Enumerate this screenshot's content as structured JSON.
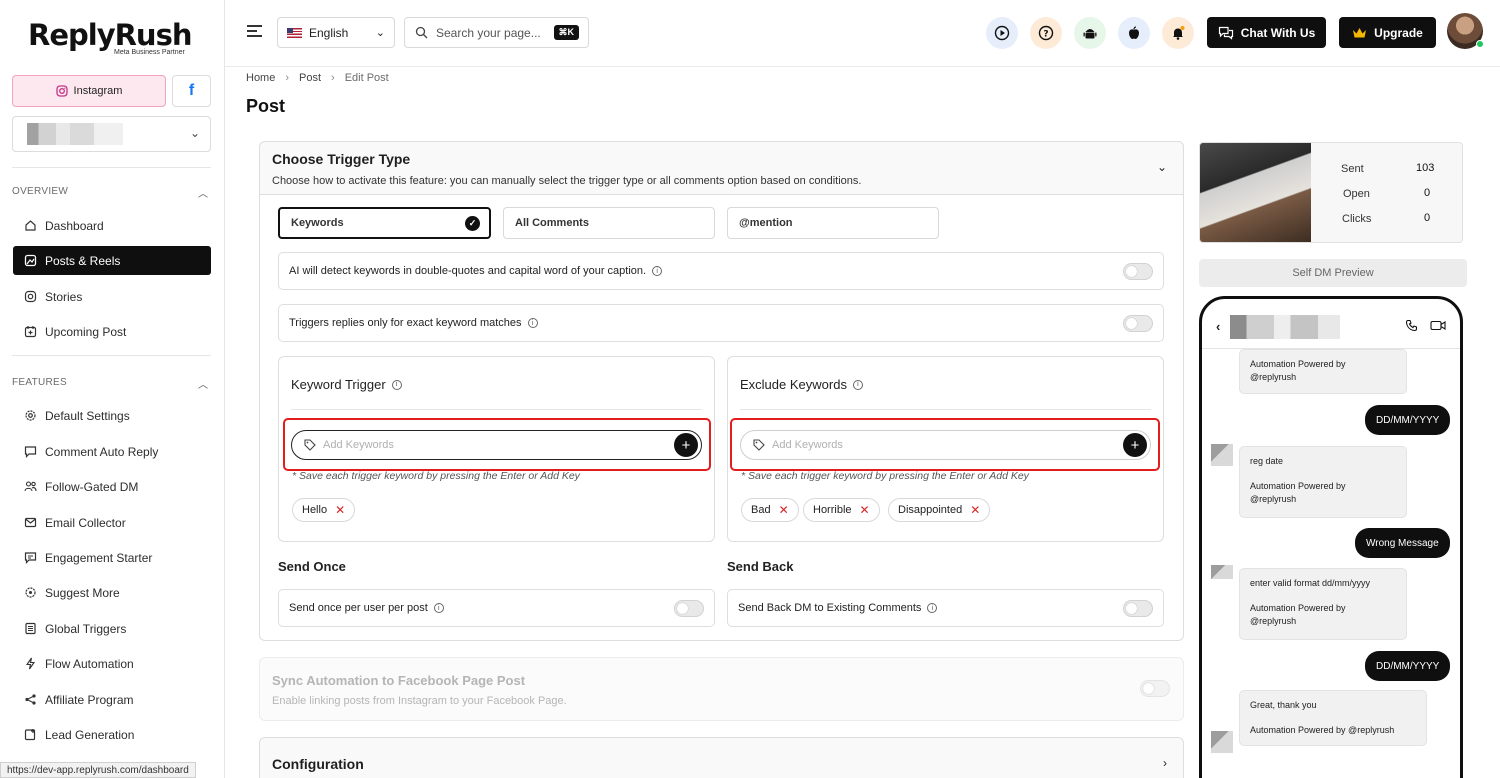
{
  "sidebar": {
    "logo": "ReplyRush",
    "logo_sub": "Meta Business Partner",
    "instagram_label": "Instagram",
    "fb_icon": "f",
    "sections": {
      "overview": "OVERVIEW",
      "features": "FEATURES"
    },
    "overview_items": [
      {
        "label": "Dashboard",
        "icon": "dashboard-icon"
      },
      {
        "label": "Posts & Reels",
        "icon": "posts-icon",
        "active": true
      },
      {
        "label": "Stories",
        "icon": "stories-icon"
      },
      {
        "label": "Upcoming Post",
        "icon": "calendar-icon"
      }
    ],
    "feature_items": [
      {
        "label": "Default Settings",
        "icon": "gear-icon"
      },
      {
        "label": "Comment Auto Reply",
        "icon": "comment-icon"
      },
      {
        "label": "Follow-Gated DM",
        "icon": "users-icon"
      },
      {
        "label": "Email Collector",
        "icon": "mail-icon"
      },
      {
        "label": "Engagement Starter",
        "icon": "engage-icon"
      },
      {
        "label": "Suggest More",
        "icon": "suggest-icon"
      },
      {
        "label": "Global Triggers",
        "icon": "list-icon"
      },
      {
        "label": "Flow Automation",
        "icon": "flow-icon"
      },
      {
        "label": "Affiliate Program",
        "icon": "share-icon"
      },
      {
        "label": "Lead Generation",
        "icon": "lead-icon"
      }
    ],
    "status_url": "https://dev-app.replyrush.com/dashboard"
  },
  "header": {
    "language": "English",
    "search_placeholder": "Search your page...",
    "search_shortcut": "⌘K",
    "chat_button": "Chat With Us",
    "upgrade_button": "Upgrade"
  },
  "breadcrumb": [
    "Home",
    "Post",
    "Edit Post"
  ],
  "page_title": "Post",
  "trigger": {
    "title": "Choose Trigger Type",
    "subtitle": "Choose how to activate this feature: you can manually select the trigger type or all comments option based on conditions.",
    "tabs": [
      "Keywords",
      "All Comments",
      "@mention"
    ],
    "selected_tab": "Keywords",
    "ai_detect": "AI will detect keywords in double-quotes and capital word of your caption.",
    "exact_match": "Triggers replies only for exact keyword matches",
    "keyword_trigger": {
      "title": "Keyword Trigger",
      "placeholder": "Add Keywords",
      "hint": "* Save each trigger keyword by pressing the Enter or Add Key",
      "chips": [
        "Hello"
      ]
    },
    "exclude_keywords": {
      "title": "Exclude Keywords",
      "placeholder": "Add Keywords",
      "hint": "* Save each trigger keyword by pressing the Enter or Add Key",
      "chips": [
        "Bad",
        "Horrible",
        "Disappointed"
      ]
    },
    "send_once": {
      "title": "Send Once",
      "label": "Send once per user per post"
    },
    "send_back": {
      "title": "Send Back",
      "label": "Send Back DM to Existing Comments"
    }
  },
  "sync": {
    "title": "Sync Automation to Facebook Page Post",
    "subtitle": "Enable linking posts from Instagram to your Facebook Page."
  },
  "configuration": {
    "title": "Configuration"
  },
  "preview": {
    "stats": [
      {
        "label": "Sent",
        "value": "103"
      },
      {
        "label": "Open",
        "value": "0"
      },
      {
        "label": "Clicks",
        "value": "0"
      }
    ],
    "self_dm_label": "Self DM Preview",
    "messages": {
      "m1_line2": "Automation Powered by",
      "m1_line3": "@replyrush",
      "out1": "DD/MM/YYYY",
      "m2_line1": "reg date",
      "m2_line2": "Automation Powered by",
      "m2_line3": "@replyrush",
      "out2": "Wrong Message",
      "m3_line1": "enter valid format dd/mm/yyyy",
      "m3_line2": "Automation Powered by",
      "m3_line3": "@replyrush",
      "out3": "DD/MM/YYYY",
      "m4_line1": "Great, thank you",
      "m4_line2": "Automation Powered by @replyrush"
    }
  }
}
